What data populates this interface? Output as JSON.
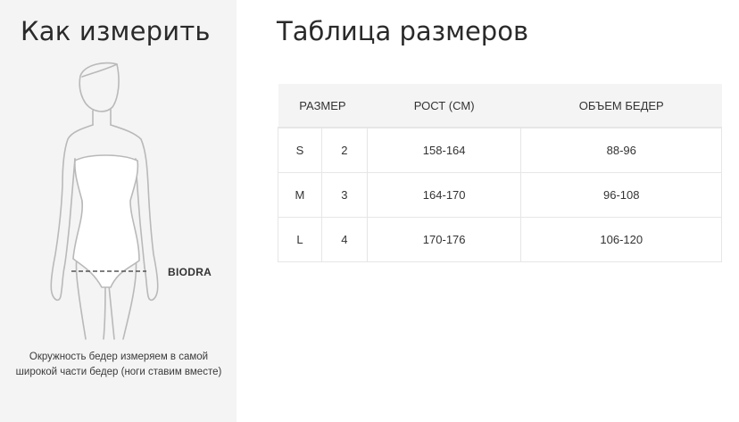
{
  "how_to_measure": {
    "title": "Как измерить",
    "marker_label": "BIODRA",
    "caption": "Окружность бедер измеряем в самой широкой части бедер (ноги ставим вместе)"
  },
  "size_chart": {
    "title": "Таблица размеров",
    "headers": {
      "size": "РАЗМЕР",
      "height": "РОСТ (СМ)",
      "hips": "ОБЪЕМ БЕДЕР"
    },
    "rows": [
      {
        "size_letter": "S",
        "size_number": "2",
        "height": "158-164",
        "hips": "88-96"
      },
      {
        "size_letter": "M",
        "size_number": "3",
        "height": "164-170",
        "hips": "96-108"
      },
      {
        "size_letter": "L",
        "size_number": "4",
        "height": "170-176",
        "hips": "106-120"
      }
    ]
  }
}
